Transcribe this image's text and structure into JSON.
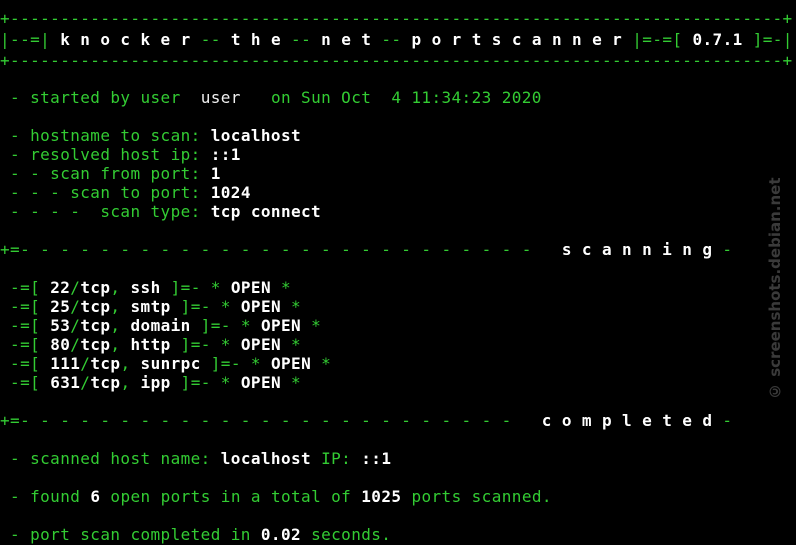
{
  "banner": {
    "border": "+-----------------------------------------------------------------------------+",
    "left_bracket": "|--=|",
    "title_w1": "k n o c k e r",
    "sep": "--",
    "title_w2": "t h e",
    "title_w3": "n e t",
    "title_w4": "p o r t s c a n n e r",
    "mid": "|=-=[",
    "version": "0.7.1",
    "right_bracket": "]=-|"
  },
  "info": {
    "started_prefix": "- started by user",
    "user": "user",
    "on_date": "on Sun Oct  4 11:34:23 2020",
    "hostname_label": "- hostname to scan:",
    "hostname": "localhost",
    "ip_label": "- resolved host ip:",
    "ip": "::1",
    "from_label": "- - scan from port:",
    "from_port": "1",
    "to_label": "- - - scan to port:",
    "to_port": "1024",
    "type_label": "- - - -  scan type:",
    "scan_type": "tcp connect"
  },
  "scanning_divider": {
    "dashes": "+=- - - - - - - - - - - - - - - - - - - - - - - - - -",
    "word": "s c a n n i n g",
    "tail": "-"
  },
  "ports": [
    {
      "port": "22",
      "proto": "tcp",
      "service": "ssh",
      "status": "OPEN"
    },
    {
      "port": "25",
      "proto": "tcp",
      "service": "smtp",
      "status": "OPEN"
    },
    {
      "port": "53",
      "proto": "tcp",
      "service": "domain",
      "status": "OPEN"
    },
    {
      "port": "80",
      "proto": "tcp",
      "service": "http",
      "status": "OPEN"
    },
    {
      "port": "111",
      "proto": "tcp",
      "service": "sunrpc",
      "status": "OPEN"
    },
    {
      "port": "631",
      "proto": "tcp",
      "service": "ipp",
      "status": "OPEN"
    }
  ],
  "completed_divider": {
    "dashes": "+=- - - - - - - - - - - - - - - - - - - - - - - - -",
    "word": "c o m p l e t e d",
    "tail": "-"
  },
  "summary": {
    "scanned_label": "- scanned host name:",
    "scanned_host": "localhost",
    "ip_label": "IP:",
    "ip": "::1",
    "found_prefix": "- found",
    "found_count": "6",
    "found_mid": "open ports in a total of",
    "total_ports": "1025",
    "found_suffix": "ports scanned.",
    "time_prefix": "- port scan completed in",
    "time": "0.02",
    "time_suffix": "seconds."
  },
  "watermark": "© screenshots.debian.net"
}
